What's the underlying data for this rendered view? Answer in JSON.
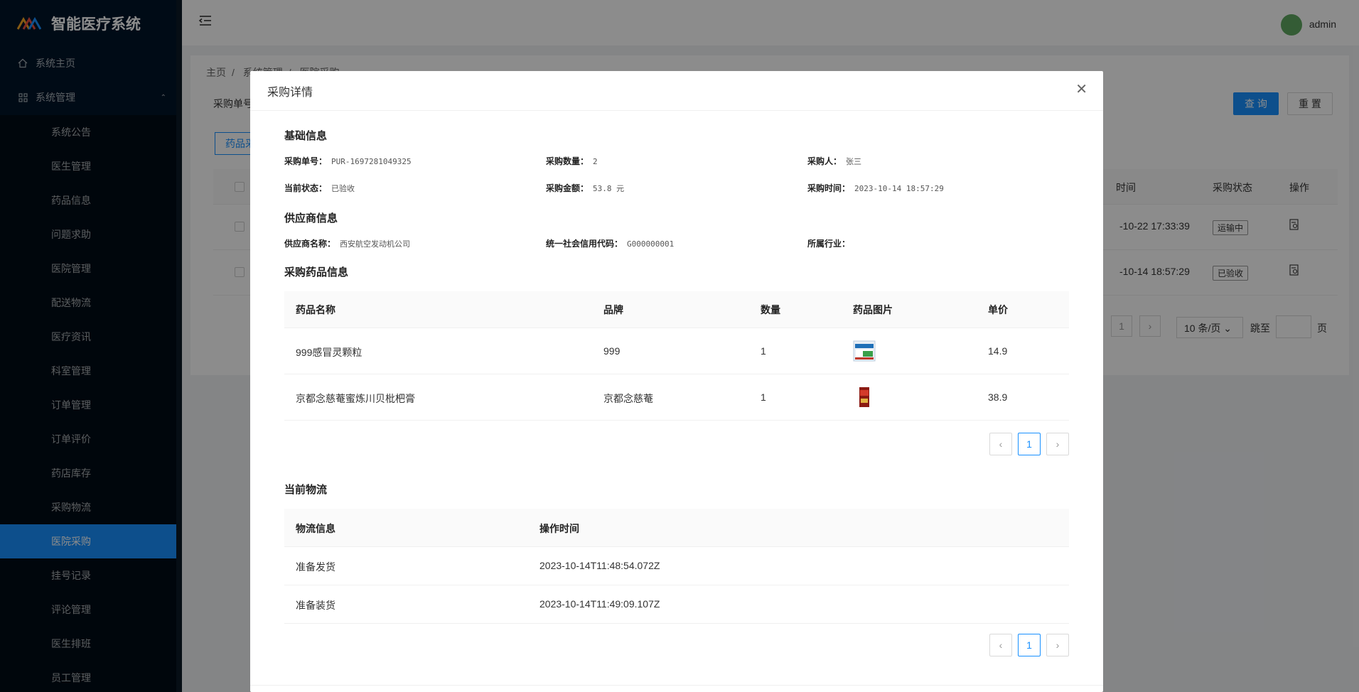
{
  "app": {
    "title": "智能医疗系统"
  },
  "sidebar": {
    "home": "系统主页",
    "group": "系统管理",
    "items": [
      "系统公告",
      "医生管理",
      "药品信息",
      "问题求助",
      "医院管理",
      "配送物流",
      "医疗资讯",
      "科室管理",
      "订单管理",
      "订单评价",
      "药店库存",
      "采购物流",
      "医院采购",
      "挂号记录",
      "评论管理",
      "医生排班",
      "员工管理"
    ],
    "active": "医院采购"
  },
  "header": {
    "username": "admin"
  },
  "background": {
    "breadcrumb": [
      "主页",
      "系统管理",
      "医院采购"
    ],
    "search_label": "采购单号",
    "query_label": "查 询",
    "reset_label": "重 置",
    "drug_button": "药品采",
    "columns": {
      "time": "时间",
      "status": "采购状态",
      "action": "操作"
    },
    "rows": [
      {
        "time": "-10-22 17:33:39",
        "status": "运输中"
      },
      {
        "time": "-10-14 18:57:29",
        "status": "已验收"
      }
    ],
    "pager": {
      "page": "1",
      "size": "10 条/页",
      "jump": "跳至",
      "unit": "页"
    }
  },
  "modal": {
    "title": "采购详情",
    "basic": {
      "title": "基础信息",
      "order_no_k": "采购单号：",
      "order_no_v": "PUR-1697281049325",
      "qty_k": "采购数量：",
      "qty_v": "2",
      "buyer_k": "采购人：",
      "buyer_v": "张三",
      "status_k": "当前状态：",
      "status_v": "已验收",
      "amount_k": "采购金额：",
      "amount_v": "53.8 元",
      "time_k": "采购时间：",
      "time_v": "2023-10-14 18:57:29"
    },
    "supplier": {
      "title": "供应商信息",
      "name_k": "供应商名称：",
      "name_v": "西安航空发动机公司",
      "code_k": "统一社会信用代码：",
      "code_v": "G000000001",
      "industry_k": "所属行业：",
      "industry_v": ""
    },
    "drugs": {
      "title": "采购药品信息",
      "headers": [
        "药品名称",
        "品牌",
        "数量",
        "药品图片",
        "单价"
      ],
      "rows": [
        {
          "name": "999感冒灵颗粒",
          "brand": "999",
          "qty": "1",
          "price": "14.9"
        },
        {
          "name": "京都念慈菴蜜炼川贝枇杷膏",
          "brand": "京都念慈菴",
          "qty": "1",
          "price": "38.9"
        }
      ],
      "page": "1"
    },
    "logistics": {
      "title": "当前物流",
      "headers": [
        "物流信息",
        "操作时间"
      ],
      "rows": [
        {
          "info": "准备发货",
          "time": "2023-10-14T11:48:54.072Z"
        },
        {
          "info": "准备装货",
          "time": "2023-10-14T11:49:09.107Z"
        }
      ],
      "page": "1"
    }
  }
}
